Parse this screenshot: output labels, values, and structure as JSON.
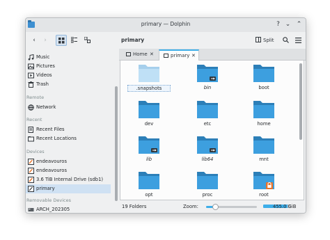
{
  "window": {
    "title": "primary — Dolphin",
    "app_icon": "folder-icon"
  },
  "toolbar": {
    "back": "‹",
    "forward": "›",
    "view_modes": [
      "icons-view-icon",
      "compact-view-icon",
      "details-view-icon"
    ],
    "breadcrumb": "primary",
    "split_label": "Split",
    "search": "search-icon",
    "menu": "hamburger-menu-icon"
  },
  "sidebar": {
    "places": [
      {
        "label": "Music",
        "icon": "music-icon"
      },
      {
        "label": "Pictures",
        "icon": "pictures-icon"
      },
      {
        "label": "Videos",
        "icon": "videos-icon"
      },
      {
        "label": "Trash",
        "icon": "trash-icon"
      }
    ],
    "remote_heading": "Remote",
    "remote": [
      {
        "label": "Network",
        "icon": "network-icon"
      }
    ],
    "recent_heading": "Recent",
    "recent": [
      {
        "label": "Recent Files",
        "icon": "recent-files-icon"
      },
      {
        "label": "Recent Locations",
        "icon": "recent-locations-icon"
      }
    ],
    "devices_heading": "Devices",
    "devices": [
      {
        "label": "endeavouros",
        "icon": "drive-icon"
      },
      {
        "label": "endeavouros",
        "icon": "drive-icon"
      },
      {
        "label": "3.6 TiB Internal Drive (sdb1)",
        "icon": "drive-icon"
      },
      {
        "label": "primary",
        "icon": "drive-icon",
        "selected": true
      }
    ],
    "removable_heading": "Removable Devices",
    "removable": [
      {
        "label": "ARCH_202305",
        "icon": "usb-icon"
      }
    ]
  },
  "tabs": [
    {
      "label": "Home",
      "active": false
    },
    {
      "label": "primary",
      "active": true
    }
  ],
  "files": [
    {
      "name": ".snapshots",
      "style": "faded",
      "selected": true,
      "italic": false
    },
    {
      "name": "bin",
      "style": "link",
      "italic": true
    },
    {
      "name": "boot",
      "style": "normal",
      "italic": false
    },
    {
      "name": "dev",
      "style": "normal",
      "italic": false
    },
    {
      "name": "etc",
      "style": "normal",
      "italic": false
    },
    {
      "name": "home",
      "style": "normal",
      "italic": false
    },
    {
      "name": "lib",
      "style": "link",
      "italic": true
    },
    {
      "name": "lib64",
      "style": "link",
      "italic": true
    },
    {
      "name": "mnt",
      "style": "normal",
      "italic": false
    },
    {
      "name": "opt",
      "style": "normal",
      "italic": false
    },
    {
      "name": "proc",
      "style": "normal",
      "italic": false
    },
    {
      "name": "root",
      "style": "locked",
      "italic": false
    }
  ],
  "status": {
    "count": "19 Folders",
    "zoom_label": "Zoom:",
    "zoom_level": 0.18,
    "free_space": "455.0 GiB free",
    "used_fraction": 0.88
  },
  "colors": {
    "folder": "#3d9fdf",
    "folder_dark": "#2c7fb8",
    "accent": "#3daee9"
  }
}
